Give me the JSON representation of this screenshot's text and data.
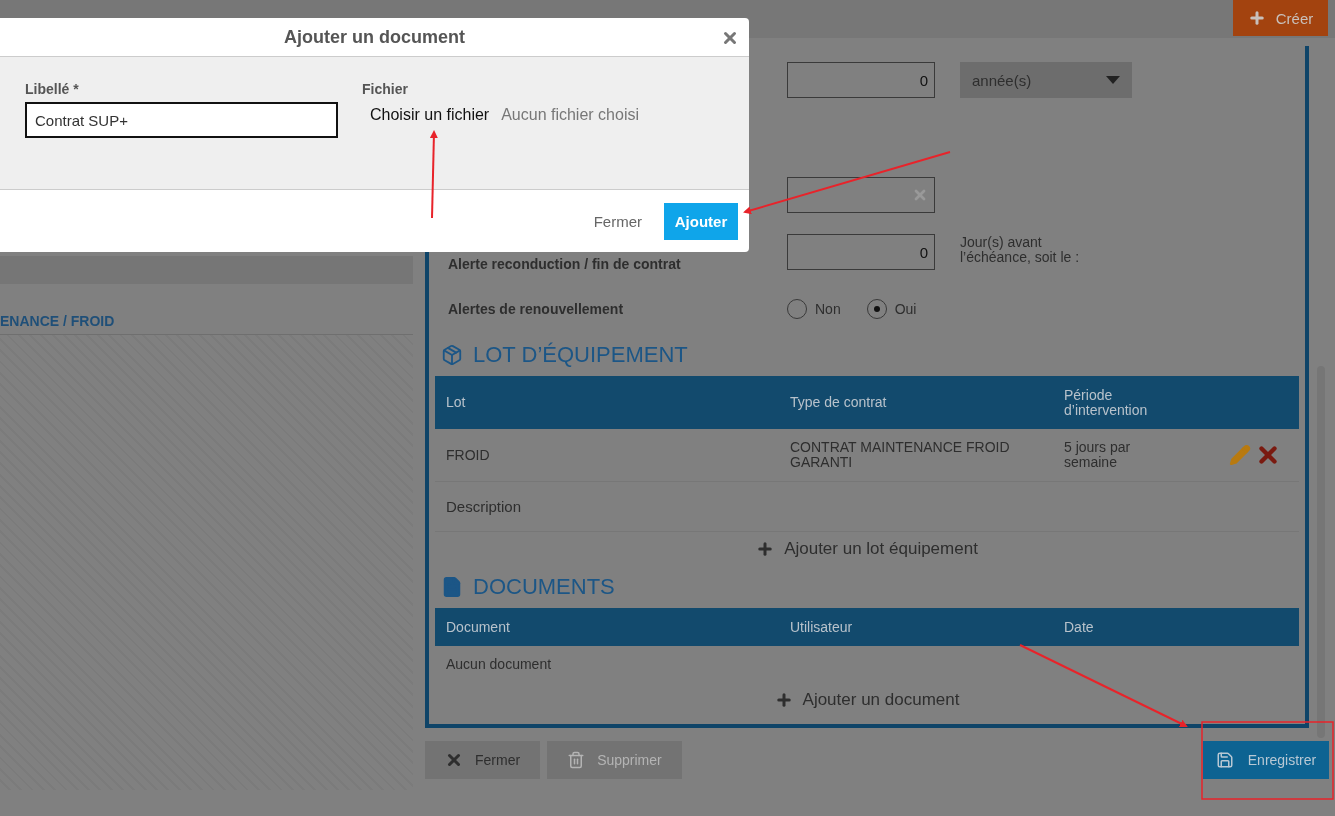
{
  "topbar": {
    "create_button": "Créer"
  },
  "left_panel": {
    "heading": "ENANCE / FROID"
  },
  "duration": {
    "value": "0",
    "unit": "année(s)"
  },
  "renewal_notice": {
    "label": "Alerte reconduction / fin de contrat",
    "value": "0",
    "suffix": "Jour(s) avant l’échéance, soit le :"
  },
  "renewal_alerts": {
    "label": "Alertes de renouvellement",
    "options": [
      {
        "label": "Non",
        "selected": false
      },
      {
        "label": "Oui",
        "selected": true
      }
    ]
  },
  "equipment": {
    "title": "LOT D’ÉQUIPEMENT",
    "columns": [
      "Lot",
      "Type de contrat",
      "Période d’intervention"
    ],
    "rows": [
      {
        "lot": "FROID",
        "contract_type": "CONTRAT MAINTENANCE FROID GARANTI",
        "period": "5 jours par semaine"
      }
    ],
    "description": "Description",
    "add_button": "Ajouter un lot équipement"
  },
  "documents": {
    "title": "DOCUMENTS",
    "columns": [
      "Document",
      "Utilisateur",
      "Date"
    ],
    "empty": "Aucun document",
    "add_button": "Ajouter un document"
  },
  "footer": {
    "close": "Fermer",
    "delete": {
      "label": "Supprimer",
      "disabled": true
    },
    "save": "Enregistrer"
  },
  "modal": {
    "title": "Ajouter un document",
    "label_field": {
      "label": "Libellé *",
      "value": "Contrat SUP+"
    },
    "file_field": {
      "label": "Fichier",
      "button": "Choisir un fichier",
      "status": "Aucun fichier choisi"
    },
    "close": "Fermer",
    "submit": "Ajouter"
  }
}
